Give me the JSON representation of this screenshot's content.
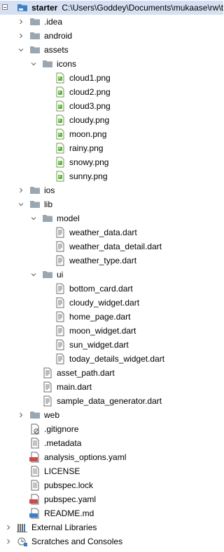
{
  "project": {
    "name": "starter",
    "path": "C:\\Users\\Goddey\\Documents\\mukaase\\rw\\t"
  },
  "tree": {
    "idea": ".idea",
    "android": "android",
    "assets": "assets",
    "icons": "icons",
    "icon_files": [
      "cloud1.png",
      "cloud2.png",
      "cloud3.png",
      "cloudy.png",
      "moon.png",
      "rainy.png",
      "snowy.png",
      "sunny.png"
    ],
    "ios": "ios",
    "lib": "lib",
    "model": "model",
    "model_files": [
      "weather_data.dart",
      "weather_data_detail.dart",
      "weather_type.dart"
    ],
    "ui": "ui",
    "ui_files": [
      "bottom_card.dart",
      "cloudy_widget.dart",
      "home_page.dart",
      "moon_widget.dart",
      "sun_widget.dart",
      "today_details_widget.dart"
    ],
    "lib_files": [
      "asset_path.dart",
      "main.dart",
      "sample_data_generator.dart"
    ],
    "web": "web",
    "root_files": [
      ".gitignore",
      ".metadata",
      "analysis_options.yaml",
      "LICENSE",
      "pubspec.lock",
      "pubspec.yaml",
      "README.md"
    ],
    "external_libraries": "External Libraries",
    "scratches": "Scratches and Consoles"
  },
  "colors": {
    "selected": "#d5e1f2",
    "folder": "#9aa7b0",
    "png": "#62b543",
    "module": "#3d7fc4"
  }
}
